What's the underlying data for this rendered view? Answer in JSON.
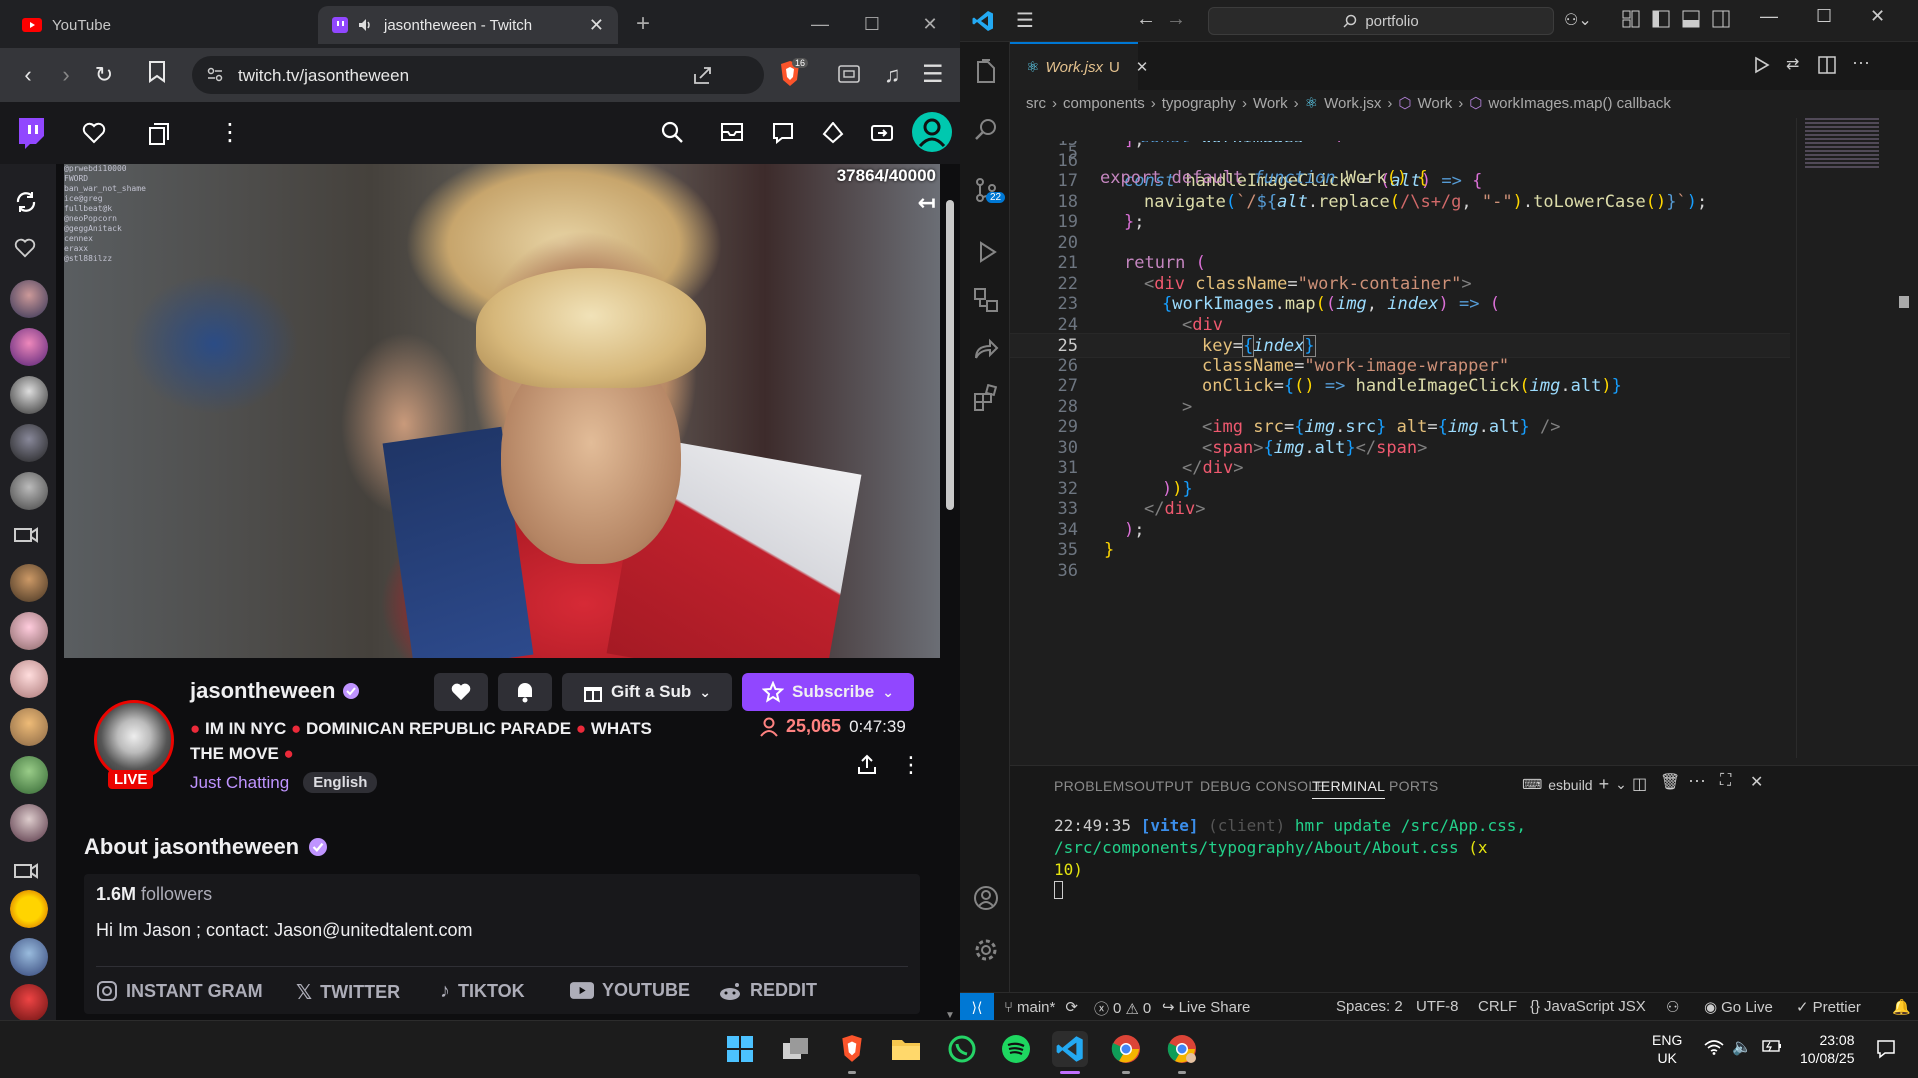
{
  "browser": {
    "tabs": [
      {
        "title": "YouTube"
      },
      {
        "title": "jasontheween - Twitch"
      }
    ],
    "new_tab": "+",
    "address": "twitch.tv/jasontheween",
    "brave_badge": "16"
  },
  "twitch": {
    "viewer_ratio": "37864/40000",
    "streamer": "jasontheween",
    "live_badge": "LIVE",
    "title_parts": [
      "IM IN NYC",
      "DOMINICAN REPUBLIC PARADE",
      "WHATS",
      "THE MOVE"
    ],
    "category": "Just Chatting",
    "language": "English",
    "gift_label": "Gift a Sub",
    "subscribe_label": "Subscribe",
    "viewers": "25,065",
    "uptime": "0:47:39",
    "about_heading": "About jasontheween",
    "followers_count": "1.6M",
    "followers_label": "followers",
    "bio": "Hi Im Jason ; contact: Jason@unitedtalent.com",
    "socials": [
      "INSTANT GRAM",
      "TWITTER",
      "TIKTOK",
      "YOUTUBE",
      "REDDIT"
    ],
    "brand_color": "#9147ff",
    "chat_overlay": [
      "@prwebdi10000",
      "FWORD",
      "ban_war_not_shame",
      "ice@greg",
      "fullbeat@k",
      "@neoPopcorn",
      "@geggAnitack",
      "cennex",
      "eraxx",
      "@stl88ilzz"
    ]
  },
  "vscode": {
    "search": "portfolio",
    "tab": {
      "name": "Work.jsx",
      "status": "U"
    },
    "breadcrumb": [
      "src",
      "components",
      "typography",
      "Work",
      "Work.jsx",
      "Work",
      "workImages.map() callback"
    ],
    "sticky": {
      "line": "5",
      "text": "export default function Work() {"
    },
    "sticky_ghost": {
      "line": "8",
      "text": "const workImages = ["
    },
    "source_control_badge": "22",
    "line_numbers": [
      "15",
      "16",
      "17",
      "18",
      "19",
      "20",
      "21",
      "22",
      "23",
      "24",
      "25",
      "26",
      "27",
      "28",
      "29",
      "30",
      "31",
      "32",
      "33",
      "34",
      "35",
      "36"
    ],
    "current_line": "25",
    "panel_tabs": [
      "PROBLEMS",
      "OUTPUT",
      "DEBUG CONSOLE",
      "TERMINAL",
      "PORTS"
    ],
    "terminal_name": "esbuild",
    "terminal": {
      "time": "22:49:35",
      "tag": "[vite]",
      "client": "(client)",
      "message": "hmr update /src/App.css, /src/components/typography/About/About.css",
      "count": "(x",
      "count2": "10)"
    },
    "status": {
      "branch": "main*",
      "errors": "0",
      "warnings": "0",
      "live_share": "Live Share",
      "spaces": "Spaces: 2",
      "encoding": "UTF-8",
      "eol": "CRLF",
      "language": "JavaScript JSX",
      "go_live": "Go Live",
      "prettier": "Prettier"
    }
  },
  "taskbar": {
    "lang1": "ENG",
    "lang2": "UK",
    "time": "23:08",
    "date": "10/08/25"
  }
}
